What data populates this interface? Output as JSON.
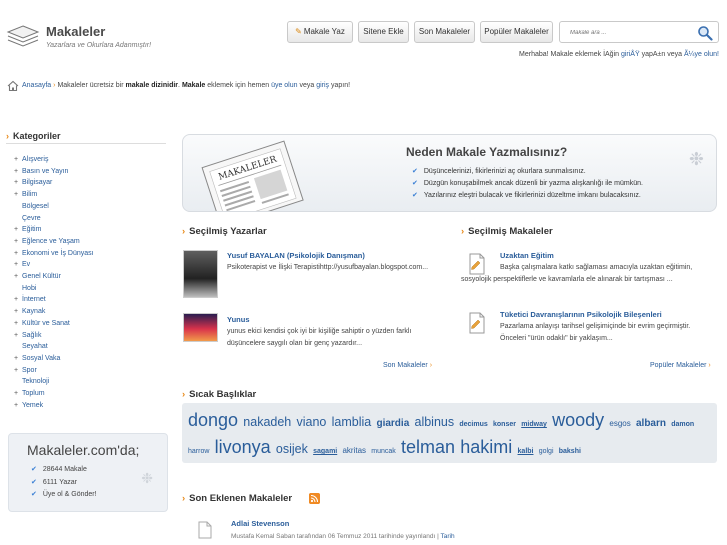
{
  "header": {
    "site_name": "Makaleler",
    "tagline": "Yazarlara ve Okurlara Adanmıştır!",
    "buttons": {
      "write": "Makale Yaz",
      "add_site": "Sitene Ekle",
      "latest": "Son Makaleler",
      "popular": "Popüler Makaleler"
    },
    "search_placeholder": "Makale ara ...",
    "welcome": {
      "prefix": "Merhaba! Makale eklemek İAğin ",
      "login": "giriÅŸ",
      "middle": " yapA±n veya ",
      "register": "Ã¼ye olun!"
    }
  },
  "breadcrumb": {
    "home": "Anasayfa",
    "text1": "Makaleler ücretsiz bir ",
    "bold1": "makale dizinidir",
    "text2": ". ",
    "bold2": "Makale",
    "text3": " eklemek için hemen ",
    "link1": "üye olun",
    "text4": " veya ",
    "link2": "giriş",
    "text5": " yapın!"
  },
  "sidebar": {
    "categories_title": "Kategoriler",
    "categories": [
      {
        "label": "Alışveriş",
        "sub": false
      },
      {
        "label": "Basın ve Yayın",
        "sub": false
      },
      {
        "label": "Bilgisayar",
        "sub": false
      },
      {
        "label": "Bilim",
        "sub": false
      },
      {
        "label": "Bölgesel",
        "sub": true
      },
      {
        "label": "Çevre",
        "sub": true
      },
      {
        "label": "Eğitim",
        "sub": false
      },
      {
        "label": "Eğlence ve Yaşam",
        "sub": false
      },
      {
        "label": "Ekonomi ve İş Dünyası",
        "sub": false
      },
      {
        "label": "Ev",
        "sub": false
      },
      {
        "label": "Genel Kültür",
        "sub": false
      },
      {
        "label": "Hobi",
        "sub": true
      },
      {
        "label": "İnternet",
        "sub": false
      },
      {
        "label": "Kaynak",
        "sub": false
      },
      {
        "label": "Kültür ve Sanat",
        "sub": false
      },
      {
        "label": "Sağlık",
        "sub": false
      },
      {
        "label": "Seyahat",
        "sub": true
      },
      {
        "label": "Sosyal Vaka",
        "sub": false
      },
      {
        "label": "Spor",
        "sub": false
      },
      {
        "label": "Teknoloji",
        "sub": true
      },
      {
        "label": "Toplum",
        "sub": false
      },
      {
        "label": "Yemek",
        "sub": false
      }
    ],
    "stats": {
      "title": "Makaleler.com'da;",
      "items": [
        "28644 Makale",
        "6111 Yazar",
        "Üye ol & Gönder!"
      ]
    }
  },
  "hero": {
    "paper_label": "MAKALELER",
    "title": "Neden Makale Yazmalısınız?",
    "items": [
      "Düşüncelerinizi, fikirlerinizi aç okurlara sunmalısınız.",
      "Düzgün konuşabilmek ancak düzenli bir yazma alışkanlığı ile mümkün.",
      "Yazılarınız eleştri bulacak ve fikirlerinizi düzeltme imkanı bulacaksınız."
    ]
  },
  "authors": {
    "title": "Seçilmiş Yazarlar",
    "items": [
      {
        "name": "Yusuf BAYALAN (Psikolojik Danışman)",
        "desc": "Psikoterapist ve İlişki Terapistihttp://yusufbayalan.blogspot.com..."
      },
      {
        "name": "Yunus",
        "desc": "yunus ekici kendisi çok iyi bir kişiliğe sahiptir o yüzden farklı düşüncelere saygılı olan bir genç yazardır..."
      }
    ],
    "more": "Son Makaleler"
  },
  "articles": {
    "title": "Seçilmiş Makaleler",
    "items": [
      {
        "title": "Uzaktan Eğitim",
        "desc": "Başka çalışmalara katkı sağlaması amacıyla uzaktan eğitimin, sosyolojik perspektiflerle ve kavramlarla ele alınarak bir tartışması ..."
      },
      {
        "title": "Tüketici Davranışlarının Psikolojik Bileşenleri",
        "desc": "Pazarlama anlayışı tarihsel gelişimiçinde bir evrim geçirmiştir. Önceleri \"ürün odaklı\" bir yaklaşım..."
      }
    ],
    "more": "Popüler Makaleler"
  },
  "hot_topics": {
    "title": "Sıcak Başlıklar",
    "tags": [
      {
        "text": "dongo",
        "size": 6,
        "bold": false,
        "underline": false
      },
      {
        "text": "nakadeh",
        "size": 4,
        "bold": false,
        "underline": false
      },
      {
        "text": "viano",
        "size": 4,
        "bold": false,
        "underline": false
      },
      {
        "text": "lamblia",
        "size": 4,
        "bold": false,
        "underline": false
      },
      {
        "text": "giardia",
        "size": 3,
        "bold": true,
        "underline": false
      },
      {
        "text": "albinus",
        "size": 4,
        "bold": false,
        "underline": false
      },
      {
        "text": "decimus",
        "size": 1,
        "bold": true,
        "underline": false
      },
      {
        "text": "konser",
        "size": 1,
        "bold": true,
        "underline": false
      },
      {
        "text": "midway",
        "size": 1,
        "bold": true,
        "underline": true
      },
      {
        "text": "woody",
        "size": 6,
        "bold": false,
        "underline": false
      },
      {
        "text": "esgos",
        "size": 2,
        "bold": false,
        "underline": false
      },
      {
        "text": "albarn",
        "size": 3,
        "bold": true,
        "underline": false
      },
      {
        "text": "damon",
        "size": 1,
        "bold": true,
        "underline": false
      },
      {
        "text": "harrow",
        "size": 1,
        "bold": false,
        "underline": false
      },
      {
        "text": "livonya",
        "size": 6,
        "bold": false,
        "underline": false
      },
      {
        "text": "osijek",
        "size": 4,
        "bold": false,
        "underline": false
      },
      {
        "text": "sagami",
        "size": 1,
        "bold": true,
        "underline": true
      },
      {
        "text": "akritas",
        "size": 2,
        "bold": false,
        "underline": false
      },
      {
        "text": "muncak",
        "size": 1,
        "bold": false,
        "underline": false
      },
      {
        "text": "telman",
        "size": 6,
        "bold": false,
        "underline": false
      },
      {
        "text": "hakimi",
        "size": 6,
        "bold": false,
        "underline": false
      },
      {
        "text": "kalbi",
        "size": 1,
        "bold": true,
        "underline": true
      },
      {
        "text": "golgi",
        "size": 1,
        "bold": false,
        "underline": false
      },
      {
        "text": "bakshi",
        "size": 1,
        "bold": true,
        "underline": false
      }
    ]
  },
  "latest": {
    "title": "Son Eklenen Makaleler",
    "items": [
      {
        "title": "Adlai Stevenson",
        "meta": "Mustafa Kemal Saban tarafından 06 Temmuz 2011 tarihinde yayınlandı | ",
        "category": "Tarih"
      }
    ]
  },
  "colors": {
    "link": "#2a5d9a",
    "accent": "#e88a1a",
    "check": "#3a7fd4"
  },
  "icons": [
    "logo-stack-icon",
    "pencil-icon",
    "search-icon",
    "home-icon",
    "check-icon",
    "paw-icon",
    "document-icon",
    "rss-icon",
    "arrow-right-icon"
  ]
}
